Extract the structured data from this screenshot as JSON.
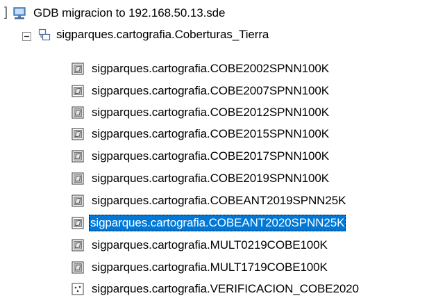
{
  "tree": {
    "root": {
      "label": "GDB migracion  to 192.168.50.13.sde",
      "icon": "database-connection-icon",
      "cut_glyph": "]"
    },
    "dataset": {
      "label": "sigparques.cartografia.Coberturas_Tierra",
      "icon": "feature-dataset-icon",
      "expander": "collapse-minus-icon"
    },
    "items": [
      {
        "label": "sigparques.cartografia.COBE2002SPNN100K",
        "icon": "polygon-feature-class-icon",
        "selected": false
      },
      {
        "label": "sigparques.cartografia.COBE2007SPNN100K",
        "icon": "polygon-feature-class-icon",
        "selected": false
      },
      {
        "label": "sigparques.cartografia.COBE2012SPNN100K",
        "icon": "polygon-feature-class-icon",
        "selected": false
      },
      {
        "label": "sigparques.cartografia.COBE2015SPNN100K",
        "icon": "polygon-feature-class-icon",
        "selected": false
      },
      {
        "label": "sigparques.cartografia.COBE2017SPNN100K",
        "icon": "polygon-feature-class-icon",
        "selected": false
      },
      {
        "label": "sigparques.cartografia.COBE2019SPNN100K",
        "icon": "polygon-feature-class-icon",
        "selected": false
      },
      {
        "label": "sigparques.cartografia.COBEANT2019SPNN25K",
        "icon": "polygon-feature-class-icon",
        "selected": false
      },
      {
        "label": "sigparques.cartografia.COBEANT2020SPNN25K",
        "icon": "polygon-feature-class-icon",
        "selected": true
      },
      {
        "label": "sigparques.cartografia.MULT0219COBE100K",
        "icon": "polygon-feature-class-icon",
        "selected": false
      },
      {
        "label": "sigparques.cartografia.MULT1719COBE100K",
        "icon": "polygon-feature-class-icon",
        "selected": false
      },
      {
        "label": "sigparques.cartografia.VERIFICACION_COBE2020",
        "icon": "point-feature-class-icon",
        "selected": false
      }
    ],
    "colors": {
      "selection_bg": "#0078d7",
      "selection_text": "#ffffff",
      "text": "#000000"
    }
  }
}
